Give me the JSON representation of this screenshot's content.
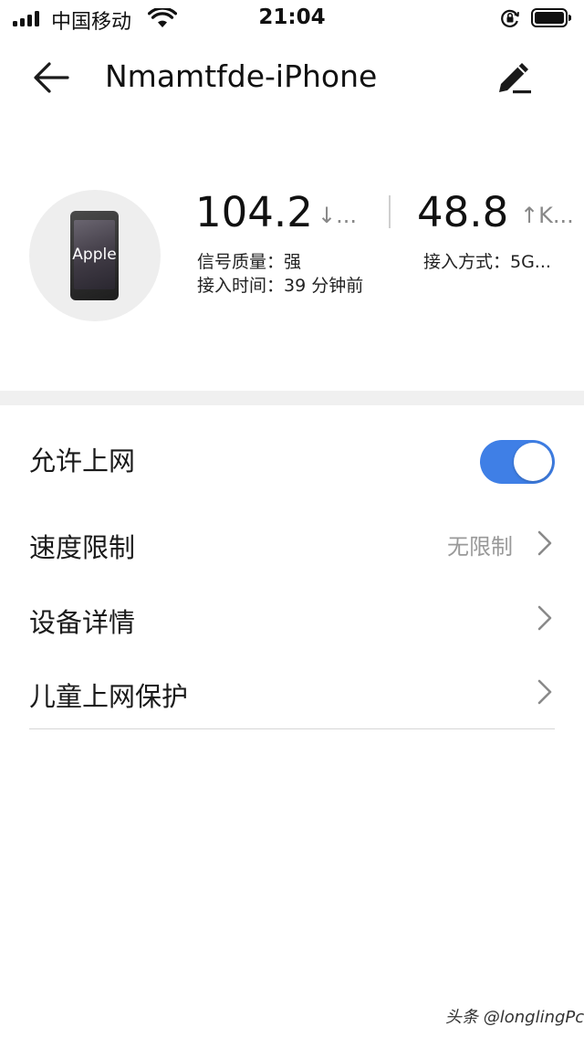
{
  "status_bar": {
    "carrier": "中国移动",
    "time": "21:04",
    "icons": [
      "signal-bars-icon",
      "wifi-icon",
      "orientation-lock-icon",
      "battery-icon"
    ]
  },
  "nav": {
    "title": "Nmamtfde-iPhone",
    "back_icon": "arrow-left-icon",
    "edit_icon": "pencil-icon"
  },
  "device": {
    "avatar_label": "Apple",
    "download_speed": "104.2",
    "download_unit": "↓...",
    "upload_speed": "48.8",
    "upload_unit": "↑K...",
    "signal_quality": "信号质量：强",
    "access_mode": "接入方式：5G...",
    "access_time": "接入时间：39 分钟前"
  },
  "settings": {
    "allow_internet": {
      "label": "允许上网",
      "enabled": true
    },
    "speed_limit": {
      "label": "速度限制",
      "value": "无限制"
    },
    "device_details": {
      "label": "设备详情"
    },
    "child_protection": {
      "label": "儿童上网保护"
    }
  },
  "colors": {
    "toggle_on": "#3f7fe6",
    "band": "#f0f0f0",
    "muted_text": "#999999"
  },
  "watermark": "头条 @longlingPc"
}
